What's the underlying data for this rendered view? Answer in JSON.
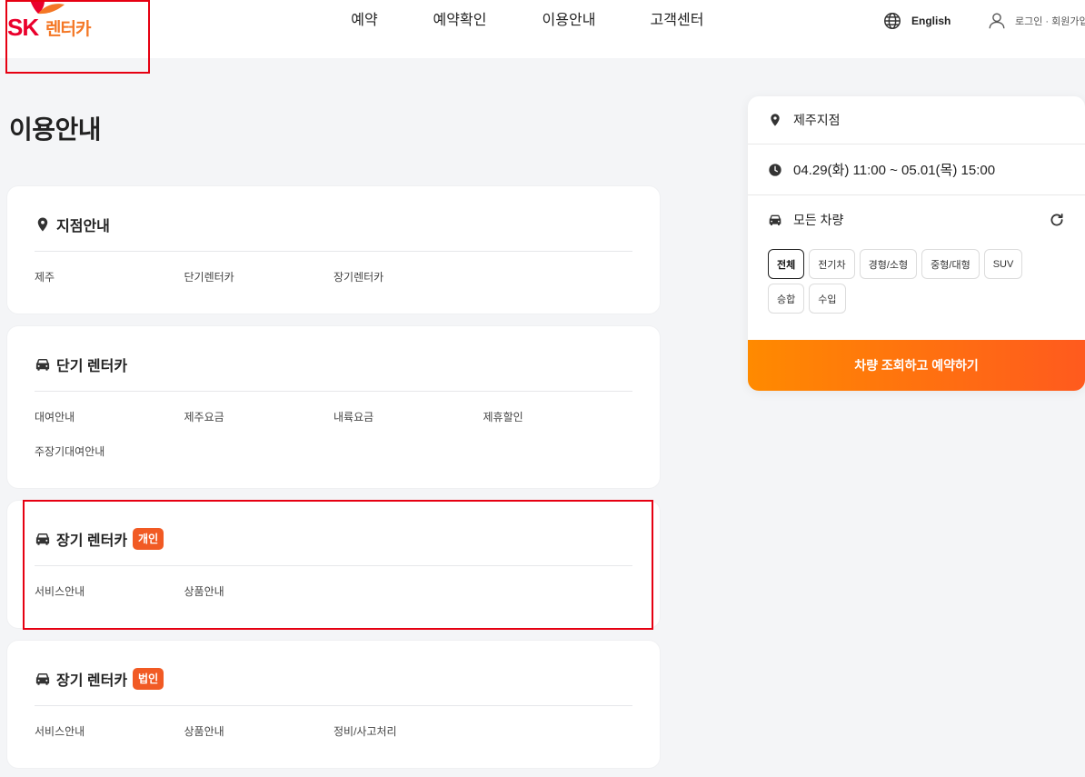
{
  "colors": {
    "page_bg": "#f4f5f7",
    "brand_red": "#ea002c",
    "brand_orange": "#f47725",
    "badge": "#f15a24",
    "cta_start": "#ff8a00",
    "cta_end": "#ff5a1e",
    "annotation": "#e60012"
  },
  "header": {
    "logo": {
      "sk": "SK",
      "brand": "렌터카",
      "icon": "sk-wings-logo"
    },
    "nav": [
      {
        "label": "예약"
      },
      {
        "label": "예약확인"
      },
      {
        "label": "이용안내"
      },
      {
        "label": "고객센터"
      }
    ],
    "language": {
      "icon": "globe-icon",
      "label": "English"
    },
    "account": {
      "icon": "user-icon",
      "label": "로그인 · 회원가입"
    }
  },
  "page_title": "이용안내",
  "sections": [
    {
      "icon": "map-pin-icon",
      "title": "지점안내",
      "links": [
        "제주",
        "단기렌터카",
        "장기렌터카"
      ]
    },
    {
      "icon": "car-icon",
      "title": "단기 렌터카",
      "links": [
        "대여안내",
        "제주요금",
        "내륙요금",
        "제휴할인",
        "주장기대여안내"
      ]
    },
    {
      "icon": "car-icon",
      "title": "장기 렌터카",
      "badge": "개인",
      "links": [
        "서비스안내",
        "상품안내"
      ]
    },
    {
      "icon": "car-icon",
      "title": "장기 렌터카",
      "badge": "법인",
      "links": [
        "서비스안내",
        "상품안내",
        "정비/사고처리"
      ]
    }
  ],
  "booking": {
    "location": {
      "icon": "map-pin-icon",
      "value": "제주지점"
    },
    "period": {
      "icon": "clock-icon",
      "value": "04.29(화) 11:00 ~ 05.01(목) 15:00"
    },
    "vehicle": {
      "icon": "car-icon",
      "label": "모든 차량",
      "reset_icon": "refresh-icon",
      "selected_index": 0,
      "chips": [
        "전체",
        "전기차",
        "경형/소형",
        "중형/대형",
        "SUV",
        "승합",
        "수입"
      ]
    },
    "submit_label": "차량 조회하고 예약하기"
  }
}
